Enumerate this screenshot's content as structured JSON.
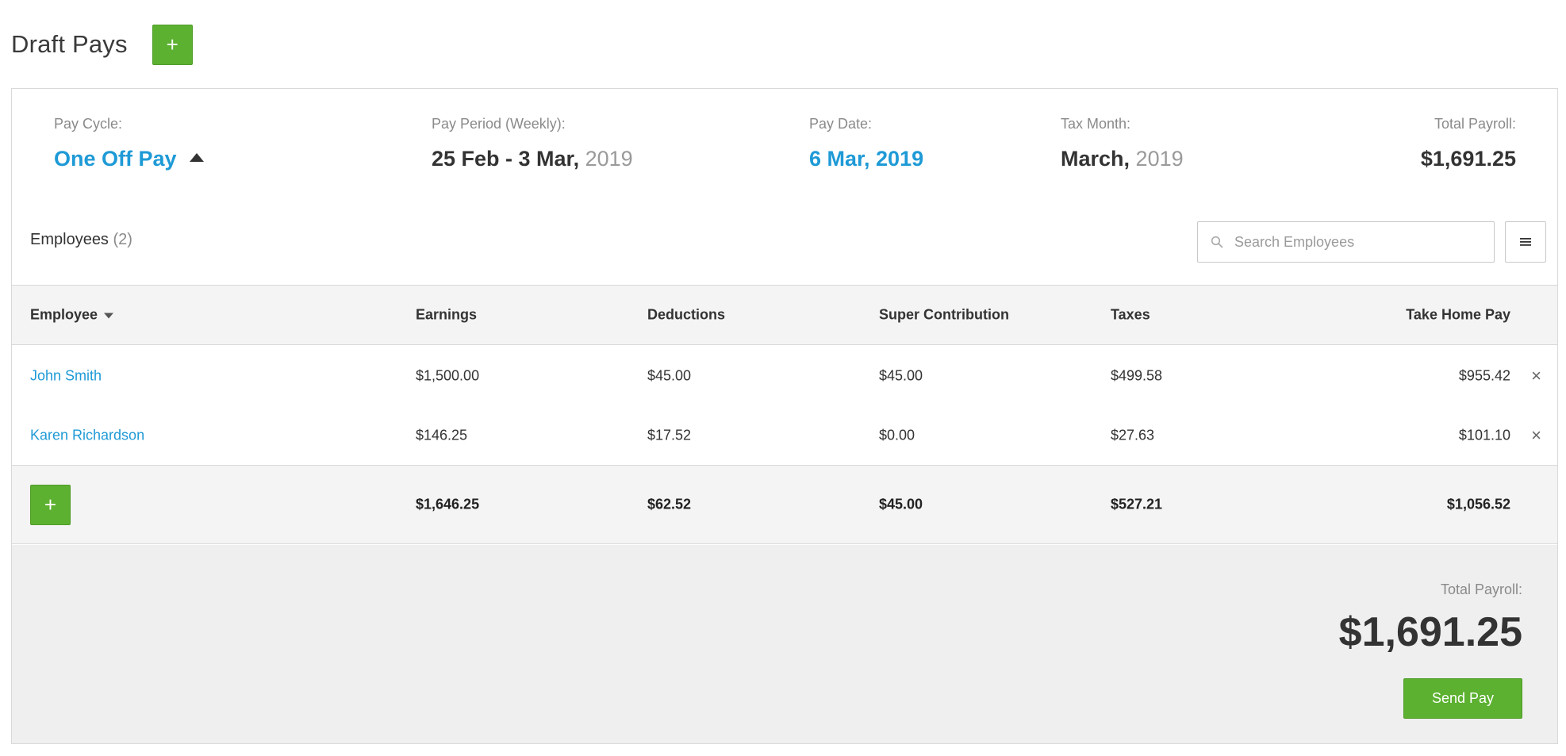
{
  "page": {
    "title": "Draft Pays",
    "add_button_label": "+"
  },
  "summary": {
    "pay_cycle": {
      "label": "Pay Cycle:",
      "value": "One Off Pay"
    },
    "pay_period": {
      "label": "Pay Period (Weekly):",
      "range": "25 Feb - 3 Mar,",
      "year": "2019"
    },
    "pay_date": {
      "label": "Pay Date:",
      "value": "6 Mar, 2019"
    },
    "tax_month": {
      "label": "Tax Month:",
      "month": "March,",
      "year": "2019"
    },
    "total_payroll": {
      "label": "Total Payroll:",
      "value": "$1,691.25"
    }
  },
  "employees": {
    "heading": "Employees",
    "count": "(2)",
    "search": {
      "placeholder": "Search Employees",
      "value": ""
    },
    "menu_icon": "hamburger-icon"
  },
  "table": {
    "columns": {
      "employee": "Employee",
      "earnings": "Earnings",
      "deductions": "Deductions",
      "super": "Super Contribution",
      "taxes": "Taxes",
      "take_home": "Take Home Pay"
    },
    "rows": [
      {
        "name": "John Smith",
        "earnings": "$1,500.00",
        "deductions": "$45.00",
        "super": "$45.00",
        "taxes": "$499.58",
        "take_home": "$955.42",
        "remove": "×"
      },
      {
        "name": "Karen Richardson",
        "earnings": "$146.25",
        "deductions": "$17.52",
        "super": "$0.00",
        "taxes": "$27.63",
        "take_home": "$101.10",
        "remove": "×"
      }
    ],
    "totals": {
      "add_label": "+",
      "earnings": "$1,646.25",
      "deductions": "$62.52",
      "super": "$45.00",
      "taxes": "$527.21",
      "take_home": "$1,056.52"
    }
  },
  "footer": {
    "total_label": "Total Payroll:",
    "total_value": "$1,691.25",
    "send_label": "Send Pay"
  },
  "colors": {
    "accent_green": "#5cb130",
    "link_blue": "#1e9ad6",
    "text_dark": "#333333",
    "text_muted": "#8a8a8a"
  }
}
